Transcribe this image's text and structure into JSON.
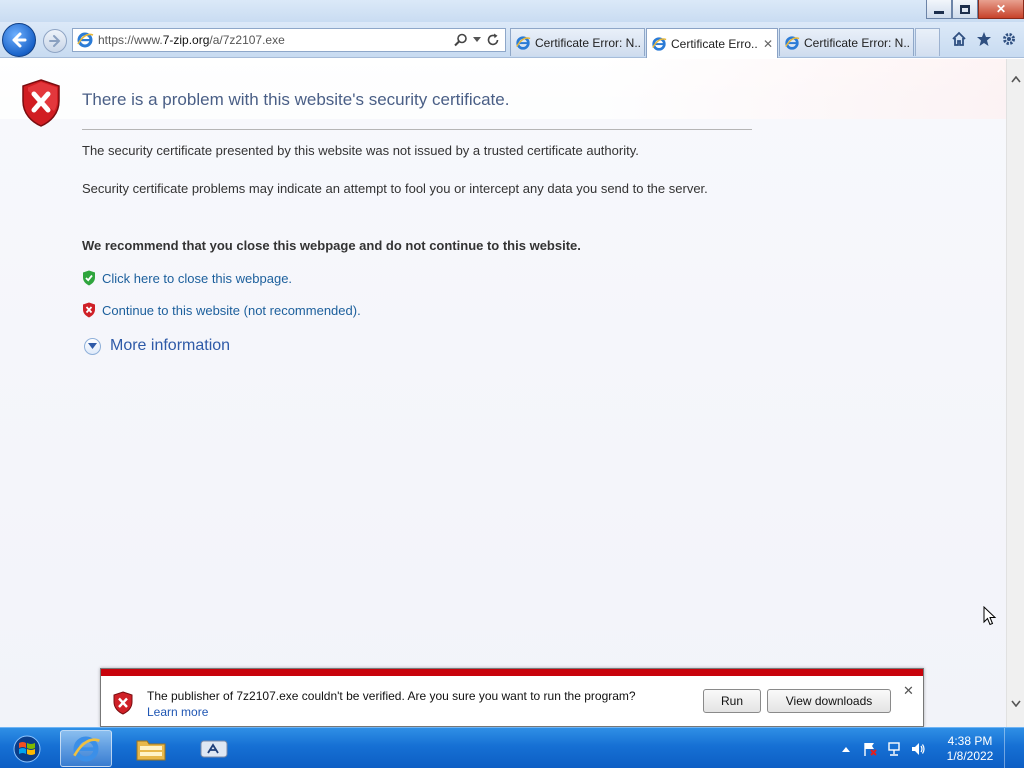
{
  "window": {
    "minimize_glyph": "–",
    "close_glyph": "✕"
  },
  "address": {
    "prefix": "https://www.",
    "domain": "7-zip.org",
    "path": "/a/7z2107.exe"
  },
  "tabs": [
    {
      "label": "Certificate Error: N...",
      "active": false
    },
    {
      "label": "Certificate Erro...",
      "active": true,
      "close": "✕"
    },
    {
      "label": "Certificate Error: N...",
      "active": false
    }
  ],
  "page": {
    "headline": "There is a problem with this website's security certificate.",
    "para1": "The security certificate presented by this website was not issued by a trusted certificate authority.",
    "para2": "Security certificate problems may indicate an attempt to fool you or intercept any data you send to the server.",
    "recommend": "We recommend that you close this webpage and do not continue to this website.",
    "close_link": "Click here to close this webpage.",
    "continue_link": "Continue to this website (not recommended).",
    "more_info": "More information"
  },
  "notification": {
    "message": "The publisher of 7z2107.exe couldn't be verified. Are you sure you want to run the program?",
    "learn_more": "Learn more",
    "run_label": "Run",
    "view_downloads_label": "View downloads",
    "close_glyph": "✕"
  },
  "taskbar": {
    "time": "4:38 PM",
    "date": "1/8/2022"
  },
  "colors": {
    "notification_bar": "#c8030c",
    "link": "#1c5f9c",
    "headline": "#4a5f86",
    "taskbar": "#1670d4"
  },
  "icons": [
    "back-arrow-icon",
    "forward-arrow-icon",
    "ie-logo-icon",
    "search-icon",
    "refresh-icon",
    "home-icon",
    "favorites-star-icon",
    "tools-gear-icon",
    "shield-error-icon",
    "shield-check-icon",
    "expand-circle-icon",
    "windows-start-icon",
    "folder-icon",
    "network-icon",
    "volume-icon",
    "flag-icon"
  ]
}
